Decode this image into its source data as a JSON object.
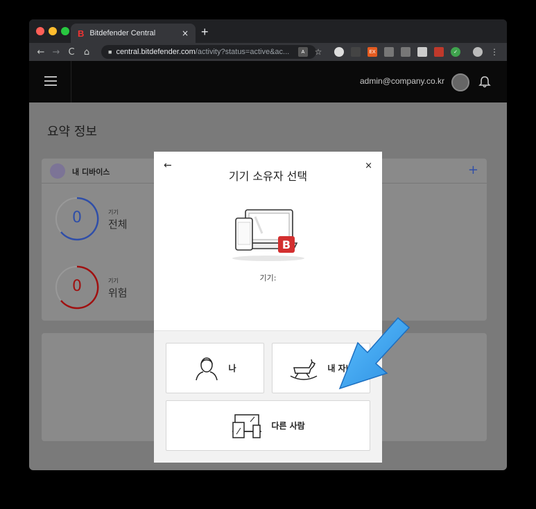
{
  "browser": {
    "tab_title": "Bitdefender Central",
    "tab_favicon": "B",
    "tab_close": "×",
    "new_tab": "+",
    "url_host": "central.bitdefender.com",
    "url_path": "/activity?status=active&ac...",
    "nav": {
      "back": "←",
      "forward": "→",
      "reload": "C",
      "home": "⌂"
    }
  },
  "app": {
    "user_email": "admin@company.co.kr",
    "page_title": "요약 정보"
  },
  "devices_card": {
    "title": "내 디바이스",
    "add": "+",
    "total": {
      "value": "0",
      "small": "기기",
      "label": "전체",
      "color": "#2f4ea8"
    },
    "risk": {
      "value": "0",
      "small": "기기",
      "label": "위험",
      "color": "#a01010"
    }
  },
  "modal": {
    "back": "←",
    "close": "×",
    "title": "기기 소유자 선택",
    "device_label": "기기:",
    "options": {
      "me": "나",
      "child": "내 자녀",
      "other": "다른 사람"
    },
    "badge": "B"
  },
  "colors": {
    "brand_red": "#d32f2f",
    "accent_blue": "#2f4ea8",
    "pointer_arrow": "#3da6f0"
  }
}
